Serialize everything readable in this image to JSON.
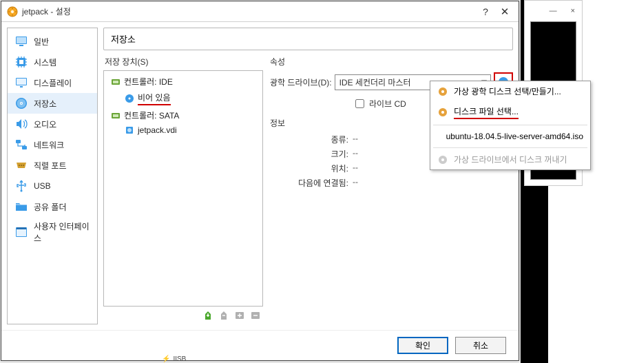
{
  "window": {
    "title": "jetpack - 설정",
    "help_glyph": "?",
    "close_glyph": "✕",
    "bg_min": "—",
    "bg_close": "×",
    "partial_text": "IISB"
  },
  "sidebar": {
    "items": [
      {
        "label": "일반",
        "icon": "monitor",
        "color": "#1582d4"
      },
      {
        "label": "시스템",
        "icon": "chip",
        "color": "#1582d4"
      },
      {
        "label": "디스플레이",
        "icon": "display",
        "color": "#1582d4"
      },
      {
        "label": "저장소",
        "icon": "disk",
        "color": "#1582d4",
        "selected": true
      },
      {
        "label": "오디오",
        "icon": "speaker",
        "color": "#1582d4"
      },
      {
        "label": "네트워크",
        "icon": "network",
        "color": "#1582d4"
      },
      {
        "label": "직렬 포트",
        "icon": "port",
        "color": "#b8860b"
      },
      {
        "label": "USB",
        "icon": "usb",
        "color": "#1582d4"
      },
      {
        "label": "공유 폴더",
        "icon": "folder",
        "color": "#1582d4"
      },
      {
        "label": "사용자 인터페이스",
        "icon": "ui",
        "color": "#1582d4"
      }
    ]
  },
  "main": {
    "header": "저장소",
    "devices_label": "저장 장치(S)",
    "tree": [
      {
        "level": 1,
        "icon": "ide",
        "label": "컨트롤러: IDE"
      },
      {
        "level": 2,
        "icon": "disc",
        "label": "비어 있음",
        "highlight": true
      },
      {
        "level": 1,
        "icon": "sata",
        "label": "컨트롤러: SATA"
      },
      {
        "level": 2,
        "icon": "hdd",
        "label": "jetpack.vdi"
      }
    ],
    "toolbar": {
      "add": "+",
      "remove": "−",
      "copy": "⎘",
      "settings": "⚙"
    }
  },
  "attr": {
    "header": "속성",
    "optical_label": "광학 드라이브(D):",
    "optical_value": "IDE 세컨더리 마스터",
    "livecd_label": "라이브 CD",
    "info_header": "정보",
    "rows": [
      {
        "label": "종류:",
        "value": "--"
      },
      {
        "label": "크기:",
        "value": "--"
      },
      {
        "label": "위치:",
        "value": "--"
      },
      {
        "label": "다음에 연결됨:",
        "value": "--"
      }
    ]
  },
  "menu": {
    "items": [
      {
        "icon": "disc",
        "label": "가상 광학 디스크 선택/만들기..."
      },
      {
        "icon": "disc",
        "label": "디스크 파일 선택...",
        "highlight": true
      }
    ],
    "recent": "ubuntu-18.04.5-live-server-amd64.iso",
    "eject": "가상 드라이브에서 디스크 꺼내기"
  },
  "footer": {
    "ok": "확인",
    "cancel": "취소"
  }
}
